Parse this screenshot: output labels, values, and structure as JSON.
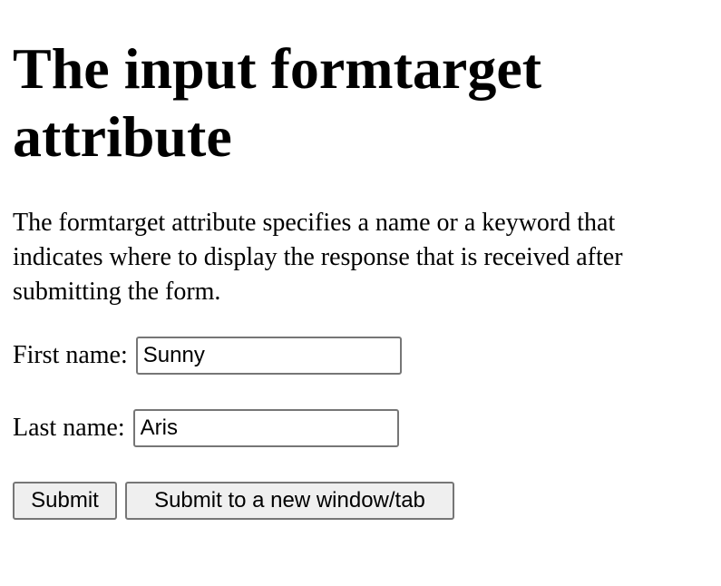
{
  "heading": "The input formtarget attribute",
  "description": "The formtarget attribute specifies a name or a keyword that indicates where to display the response that is received after submitting the form.",
  "form": {
    "first_name_label": "First name:",
    "first_name_value": "Sunny",
    "last_name_label": "Last name:",
    "last_name_value": "Aris",
    "submit_label": "Submit",
    "submit_new_window_label": "Submit to a new window/tab"
  }
}
